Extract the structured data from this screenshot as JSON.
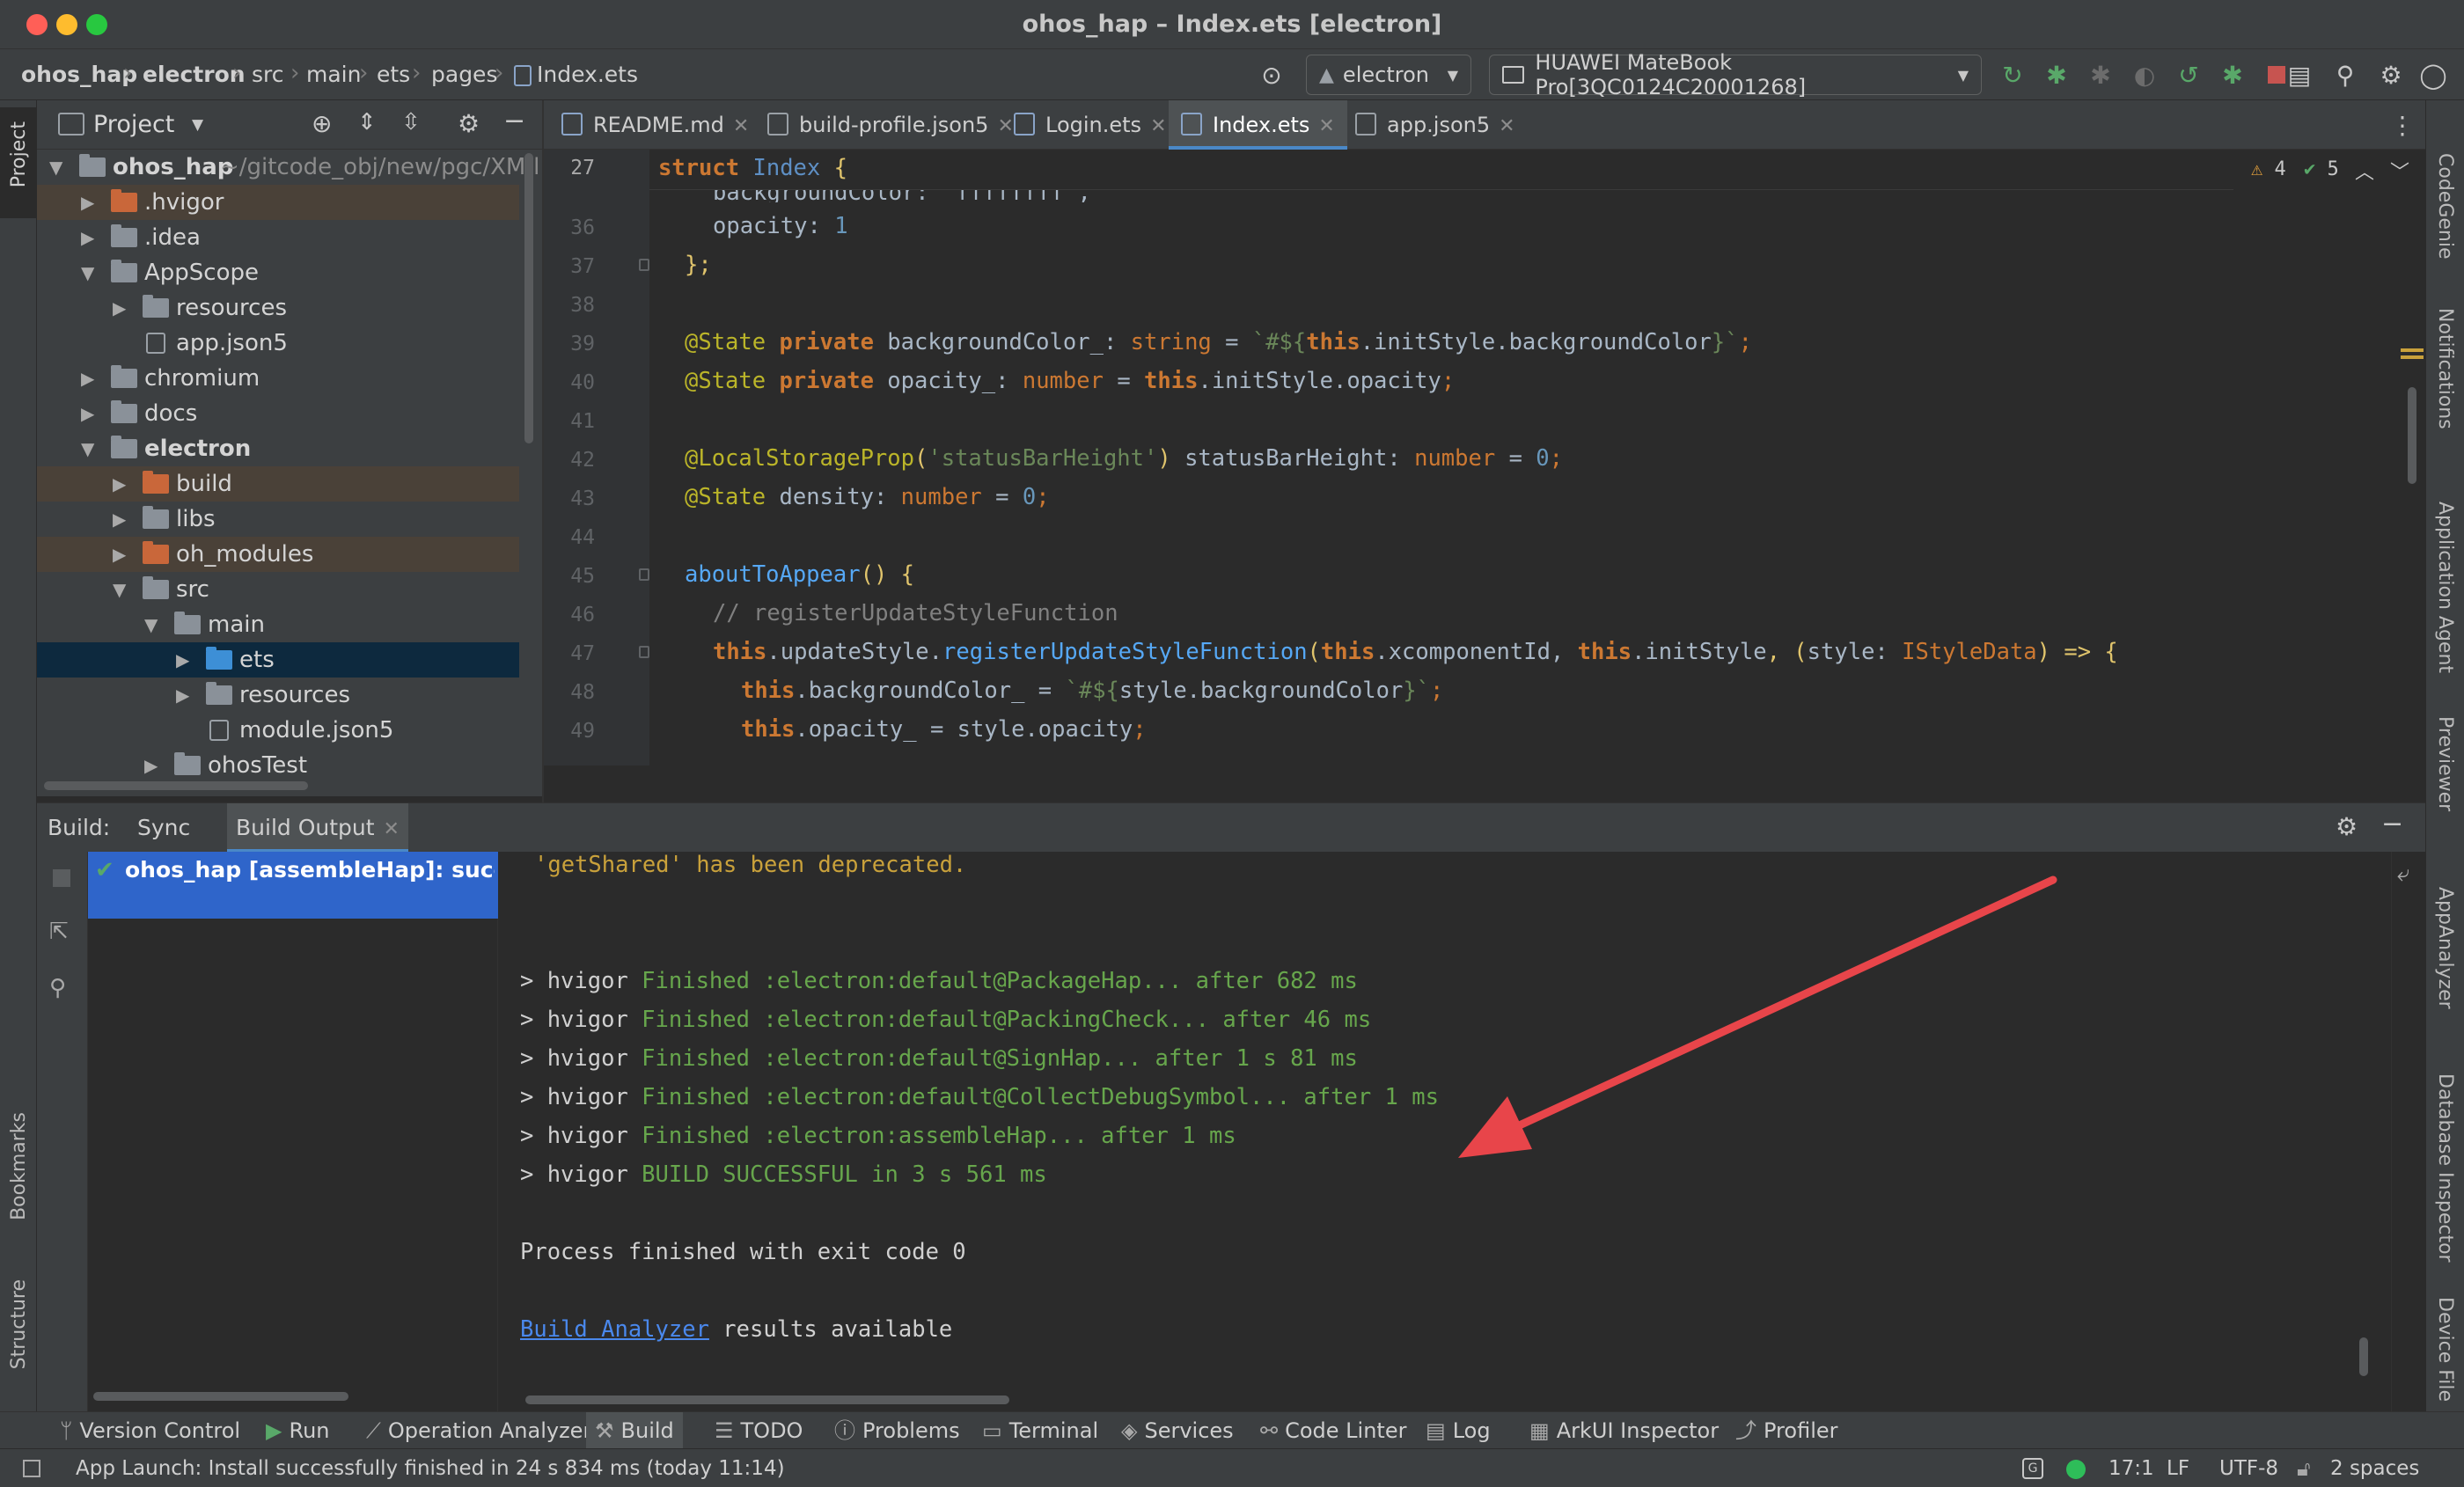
{
  "window": {
    "title": "ohos_hap – Index.ets [electron]"
  },
  "breadcrumbs": [
    "ohos_hap",
    "electron",
    "src",
    "main",
    "ets",
    "pages",
    "Index.ets"
  ],
  "toolbar": {
    "module_select": "electron",
    "device_select": "HUAWEI MateBook Pro[3QC0124C20001268]"
  },
  "left_strip": {
    "project": "Project",
    "bookmarks": "Bookmarks",
    "structure": "Structure"
  },
  "right_strip": [
    "CodeGenie",
    "Notifications",
    "Application Agent",
    "Previewer",
    "AppAnalyzer",
    "Database Inspector",
    "Device File"
  ],
  "project_panel": {
    "title": "Project",
    "root": {
      "name": "ohos_hap",
      "path": "~/gitcode_obj/new/pgc/XM/l"
    },
    "items": [
      ".hvigor",
      ".idea",
      "AppScope",
      "resources",
      "app.json5",
      "chromium",
      "docs",
      "electron",
      "build",
      "libs",
      "oh_modules",
      "src",
      "main",
      "ets",
      "resources",
      "module.json5",
      "ohosTest"
    ]
  },
  "editor_tabs": [
    "README.md",
    "build-profile.json5",
    "Login.ets",
    "Index.ets",
    "app.json5"
  ],
  "editor": {
    "sticky_line": "27",
    "sticky_code": [
      "struct",
      "Index",
      "{"
    ],
    "warnings": "4",
    "checks": "5",
    "line_numbers": [
      "36",
      "37",
      "38",
      "39",
      "40",
      "41",
      "42",
      "43",
      "44",
      "45",
      "46",
      "47",
      "48",
      "49"
    ],
    "partial_line": "backgroundColor: 'ffffffff',",
    "code": {
      "l36": [
        "opacity",
        ": ",
        "1"
      ],
      "l37": "};",
      "l39": [
        "@State",
        " private ",
        "backgroundColor_",
        ": ",
        "string",
        " = ",
        "`#${",
        "this",
        ".",
        "initStyle",
        ".",
        "backgroundColor",
        "}`",
        ";"
      ],
      "l40": [
        "@State",
        " private ",
        "opacity_",
        ": ",
        "number",
        " = ",
        "this",
        ".",
        "initStyle",
        ".",
        "opacity",
        ";"
      ],
      "l42": [
        "@LocalStorageProp",
        "(",
        "'statusBarHeight'",
        ") ",
        "statusBarHeight",
        ": ",
        "number",
        " = ",
        "0",
        ";"
      ],
      "l43": [
        "@State",
        " ",
        "density",
        ": ",
        "number",
        " = ",
        "0",
        ";"
      ],
      "l45": [
        "aboutToAppear",
        "() {"
      ],
      "l46": "// registerUpdateStyleFunction",
      "l47": [
        "this",
        ".",
        "updateStyle",
        ".",
        "registerUpdateStyleFunction",
        "(",
        "this",
        ".",
        "xcomponentId",
        ", ",
        "this",
        ".",
        "initStyle",
        ", (",
        "style",
        ": ",
        "IStyleData",
        ") => {"
      ],
      "l48": [
        "this",
        ".",
        "backgroundColor_",
        " = ",
        "`#${",
        "style",
        ".",
        "backgroundColor",
        "}`",
        ";"
      ],
      "l49": [
        "this",
        ".",
        "opacity_",
        " = ",
        "style",
        ".",
        "opacity",
        ";"
      ]
    }
  },
  "build_panel": {
    "label": "Build:",
    "tabs": [
      "Sync",
      "Build Output"
    ],
    "tree_item": "ohos_hap [assembleHap]: success",
    "output": [
      {
        "text": "'getShared' has been deprecated.",
        "kind": "warn"
      },
      {
        "text": "",
        "kind": "plain"
      },
      {
        "text": "",
        "kind": "plain"
      },
      {
        "prefix": "> hvigor ",
        "text": "Finished :electron:default@PackageHap... after 682 ms",
        "kind": "green"
      },
      {
        "prefix": "> hvigor ",
        "text": "Finished :electron:default@PackingCheck... after 46 ms",
        "kind": "green"
      },
      {
        "prefix": "> hvigor ",
        "text": "Finished :electron:default@SignHap... after 1 s 81 ms",
        "kind": "green"
      },
      {
        "prefix": "> hvigor ",
        "text": "Finished :electron:default@CollectDebugSymbol... after 1 ms",
        "kind": "green"
      },
      {
        "prefix": "> hvigor ",
        "text": "Finished :electron:assembleHap... after 1 ms",
        "kind": "green"
      },
      {
        "prefix": "> hvigor ",
        "text": "BUILD SUCCESSFUL in 3 s 561 ms",
        "kind": "green"
      },
      {
        "text": "",
        "kind": "plain"
      },
      {
        "text": "Process finished with exit code 0",
        "kind": "plain"
      },
      {
        "text": "",
        "kind": "plain"
      },
      {
        "link": "Build Analyzer",
        "text": " results available",
        "kind": "plain"
      }
    ]
  },
  "bottom_tabs": [
    "Version Control",
    "Run",
    "Operation Analyzer",
    "Build",
    "TODO",
    "Problems",
    "Terminal",
    "Services",
    "Code Linter",
    "Log",
    "ArkUI Inspector",
    "Profiler"
  ],
  "status_bar": {
    "message": "App Launch: Install successfully finished in 24 s 834 ms (today 11:14)",
    "position": "17:1",
    "line_sep": "LF",
    "encoding": "UTF-8",
    "indent": "2 spaces"
  },
  "colors": {
    "accent": "#2f65ca",
    "arrow": "#e8454a",
    "success_green": "#67a64c"
  }
}
